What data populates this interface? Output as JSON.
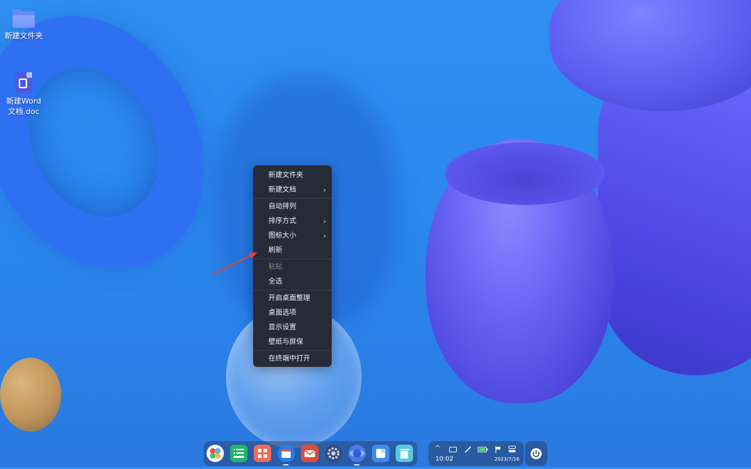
{
  "desktop": {
    "icons": [
      {
        "label": "新建文件夹",
        "icon": "folder-icon"
      },
      {
        "label_line1": "新建Word",
        "label_line2": "文档.doc",
        "icon": "word-document-icon"
      }
    ]
  },
  "context_menu": {
    "items": [
      {
        "label": "新建文件夹"
      },
      {
        "label": "新建文档",
        "has_submenu": true
      },
      {
        "label": "自动排列"
      },
      {
        "label": "排序方式",
        "has_submenu": true
      },
      {
        "label": "图标大小",
        "has_submenu": true
      },
      {
        "label": "刷新"
      },
      {
        "label": "粘贴",
        "disabled": true
      },
      {
        "label": "全选"
      },
      {
        "label": "开启桌面整理"
      },
      {
        "label": "桌面选项"
      },
      {
        "label": "显示设置"
      },
      {
        "label": "壁纸与屏保"
      },
      {
        "label": "在终端中打开"
      }
    ],
    "submenu_chevron": "›"
  },
  "dock": {
    "apps": [
      {
        "icon": "launcher-icon",
        "color": "#f2f2f2"
      },
      {
        "icon": "file-manager-icon",
        "color": "#24b36b"
      },
      {
        "icon": "app-store-icon",
        "color": "#f06a5a"
      },
      {
        "icon": "calendar-icon",
        "color": "#2d7de8"
      },
      {
        "icon": "mail-icon",
        "color": "#e24a3b"
      },
      {
        "icon": "settings-icon",
        "color": "#3a4a7a"
      },
      {
        "icon": "browser-icon",
        "color": "#4a7ae8"
      },
      {
        "icon": "notes-icon",
        "color": "#3f8cf0"
      },
      {
        "icon": "trash-icon",
        "color": "#5ac8d8"
      }
    ]
  },
  "tray": {
    "time": "10:02",
    "date": "2023/7/16",
    "icons": [
      "chevron-up-icon",
      "keyboard-icon",
      "pen-icon",
      "battery-icon",
      "flag-icon",
      "toggle-icon"
    ]
  },
  "colors": {
    "menu_bg": "#262b38",
    "menu_text": "#eef1f6",
    "menu_disabled": "#7c8290",
    "arrow": "#d9453a"
  }
}
